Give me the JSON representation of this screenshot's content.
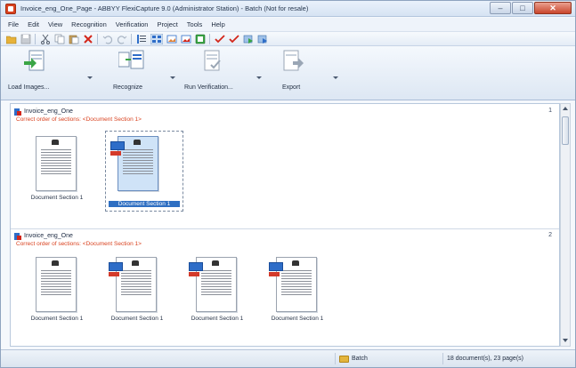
{
  "window": {
    "title": "Invoice_eng_One_Page - ABBYY FlexiCapture 9.0 (Administrator Station) - Batch (Not for resale)",
    "controls": {
      "minimize": "–",
      "maximize": "□",
      "close": "✕"
    }
  },
  "menu": [
    "File",
    "Edit",
    "View",
    "Recognition",
    "Verification",
    "Project",
    "Tools",
    "Help"
  ],
  "toolbar_big": [
    {
      "label": "Load Images...",
      "icon": "load-images-icon"
    },
    {
      "label": "Recognize",
      "icon": "recognize-icon"
    },
    {
      "label": "Run Verification...",
      "icon": "run-verification-icon"
    },
    {
      "label": "Export",
      "icon": "export-icon"
    }
  ],
  "documents": [
    {
      "name": "Invoice_eng_One",
      "number": "1",
      "note": "Correct order of sections: <Document Section 1>",
      "pages": [
        {
          "caption": "Document Section 1",
          "selected": false
        },
        {
          "caption": "Document Section 1",
          "selected": true
        }
      ]
    },
    {
      "name": "Invoice_eng_One",
      "number": "2",
      "note": "Correct order of sections: <Document Section 1>",
      "pages": [
        {
          "caption": "Document Section 1",
          "selected": false
        },
        {
          "caption": "Document Section 1",
          "selected": false
        },
        {
          "caption": "Document Section 1",
          "selected": false
        },
        {
          "caption": "Document Section 1",
          "selected": false
        }
      ]
    }
  ],
  "status": {
    "location": "Batch",
    "summary": "18 document(s), 23 page(s)"
  },
  "colors": {
    "accent": "#2f6fc2",
    "error_note": "#d9421f"
  }
}
